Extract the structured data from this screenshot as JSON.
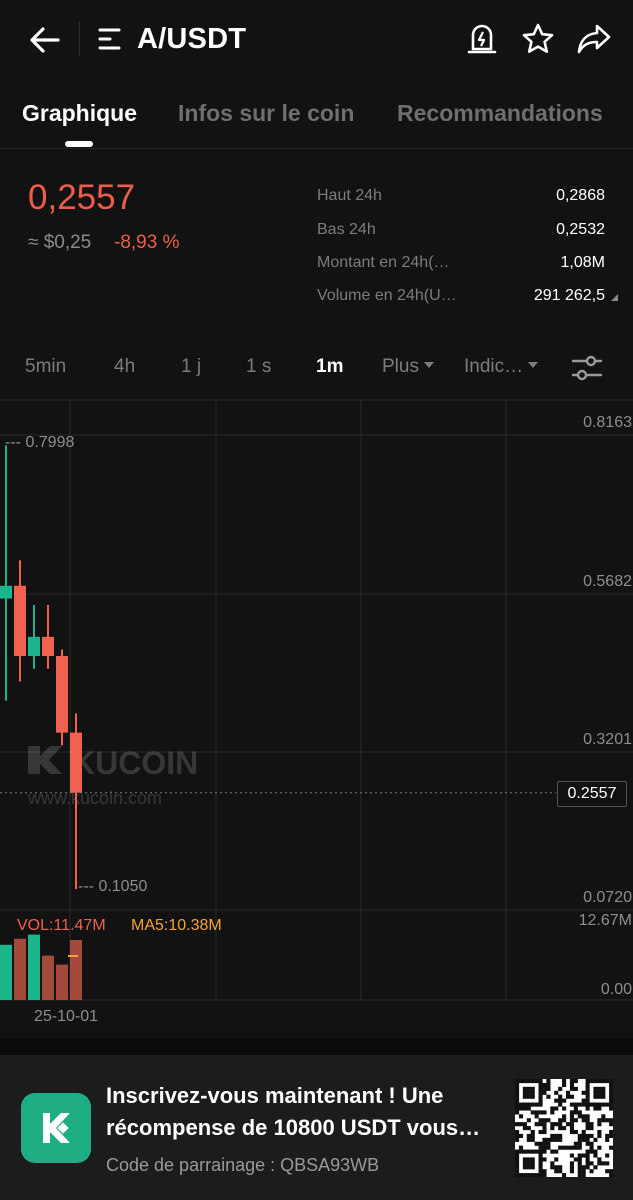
{
  "header": {
    "pair": "A/USDT"
  },
  "tabs": [
    {
      "label": "Graphique",
      "active": true
    },
    {
      "label": "Infos sur le coin",
      "active": false
    },
    {
      "label": "Recommandations",
      "active": false
    }
  ],
  "price": {
    "last": "0,2557",
    "fiat": "≈ $0,25",
    "change": "-8,93 %"
  },
  "stats": [
    {
      "label": "Haut 24h",
      "value": "0,2868"
    },
    {
      "label": "Bas 24h",
      "value": "0,2532"
    },
    {
      "label": "Montant en 24h(…",
      "value": "1,08M"
    },
    {
      "label": "Volume en 24h(U…",
      "value": "291 262,5"
    }
  ],
  "intervals": [
    "5min",
    "4h",
    "1 j",
    "1 s",
    "1m"
  ],
  "interval_active": "1m",
  "interval_more": "Plus",
  "interval_indicators": "Indic…",
  "chart": {
    "y_ticks": [
      "0.8163",
      "0.5682",
      "0.3201",
      "0.0720"
    ],
    "high_label": "0.7998",
    "low_label": "0.1050",
    "current_price": "0.2557",
    "watermark": "KUCOIN",
    "watermark_url": "www.kucoin.com",
    "vol_label": "VOL:11.47M",
    "ma5_label": "MA5:10.38M",
    "vol_max": "12.67M",
    "vol_min": "0.00",
    "date": "25-10-01",
    "colors": {
      "up": "#1bb68b",
      "down": "#f0614f",
      "ma5": "#f3a33b"
    }
  },
  "chart_data": {
    "type": "candlestick",
    "y_range": [
      0.072,
      0.8163
    ],
    "candles": [
      {
        "open": 0.56,
        "high": 0.8,
        "low": 0.4,
        "close": 0.58,
        "dir": "up"
      },
      {
        "open": 0.58,
        "high": 0.62,
        "low": 0.43,
        "close": 0.47,
        "dir": "down"
      },
      {
        "open": 0.47,
        "high": 0.55,
        "low": 0.45,
        "close": 0.5,
        "dir": "up"
      },
      {
        "open": 0.5,
        "high": 0.55,
        "low": 0.45,
        "close": 0.47,
        "dir": "down"
      },
      {
        "open": 0.47,
        "high": 0.48,
        "low": 0.33,
        "close": 0.35,
        "dir": "down"
      },
      {
        "open": 0.35,
        "high": 0.38,
        "low": 0.105,
        "close": 0.2557,
        "dir": "down"
      }
    ],
    "volume": [
      {
        "value": 9.2,
        "dir": "up"
      },
      {
        "value": 10.2,
        "dir": "down"
      },
      {
        "value": 10.9,
        "dir": "up"
      },
      {
        "value": 7.4,
        "dir": "down"
      },
      {
        "value": 5.9,
        "dir": "down"
      },
      {
        "value": 10.0,
        "dir": "down"
      }
    ],
    "volume_range": [
      0,
      12.67
    ]
  },
  "banner": {
    "title": "Inscrivez-vous maintenant ! Une récompense de 10800 USDT vous…",
    "subtitle": "Code de parrainage : QBSA93WB"
  }
}
